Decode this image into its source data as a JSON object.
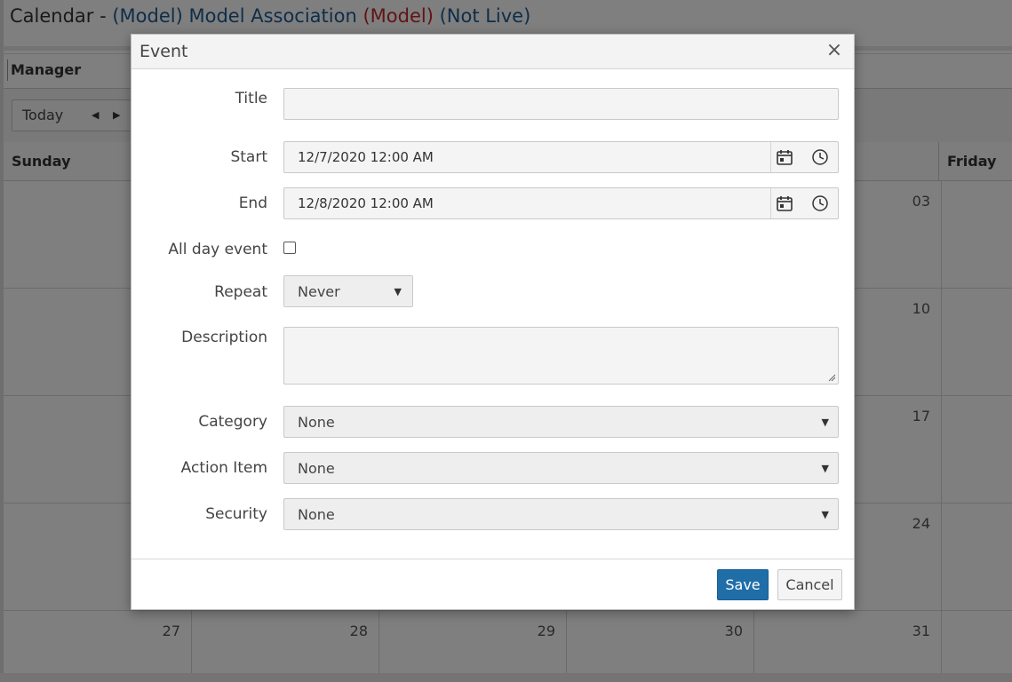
{
  "page": {
    "title_prefix": "Calendar - ",
    "title_model1": "(Model)",
    "title_name": " Model Association ",
    "title_model2": "(Model)",
    "title_status": " (Not Live)",
    "manager_label": "Manager",
    "today_label": "Today",
    "nav_prev": "◀",
    "nav_next": "▶",
    "day_sunday": "Sunday",
    "day_friday": "Friday",
    "visible_dates": {
      "r0_thu": "03",
      "r1_thu": "10",
      "r2_thu": "17",
      "r3_thu": "24",
      "r4_sun": "27",
      "r4_mon": "28",
      "r4_tue": "29",
      "r4_wed": "30",
      "r4_thu": "31"
    }
  },
  "modal": {
    "title": "Event",
    "close_glyph": "×",
    "labels": {
      "title": "Title",
      "start": "Start",
      "end": "End",
      "all_day": "All day event",
      "repeat": "Repeat",
      "description": "Description",
      "category": "Category",
      "action_item": "Action Item",
      "security": "Security"
    },
    "values": {
      "title": "",
      "start": "12/7/2020 12:00 AM",
      "end": "12/8/2020 12:00 AM",
      "all_day": false,
      "repeat": "Never",
      "description": "",
      "category": "None",
      "action_item": "None",
      "security": "None"
    },
    "icons": {
      "calendar": "calendar-icon",
      "clock": "clock-icon",
      "caret": "caret-down-icon"
    },
    "buttons": {
      "save": "Save",
      "cancel": "Cancel"
    },
    "colors": {
      "primary": "#1f6ea8",
      "title_blue": "#1f5a93",
      "title_red": "#c0282c"
    }
  }
}
